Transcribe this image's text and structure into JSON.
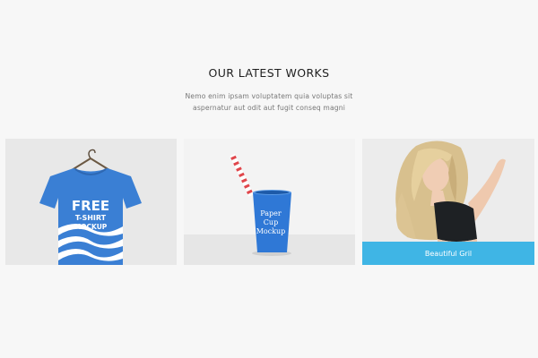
{
  "section": {
    "title": "OUR LATEST WORKS",
    "subtitle_line1": "Nemo enim ipsam voluptatem quia voluptas sit",
    "subtitle_line2": "aspernatur aut odit aut fugit conseq magni"
  },
  "portfolio": [
    {
      "image": "tshirt-mockup",
      "print": [
        "FREE",
        "T-SHIRT",
        "MOCKUP"
      ]
    },
    {
      "image": "paper-cup-mockup",
      "print": [
        "Paper",
        "Cup",
        "Mockup"
      ]
    },
    {
      "image": "girl-photo",
      "caption": "Beautiful Gril"
    }
  ],
  "colors": {
    "background": "#f7f7f7",
    "accent": "#3fb5e5",
    "mockup_blue": "#3a7fd4"
  }
}
